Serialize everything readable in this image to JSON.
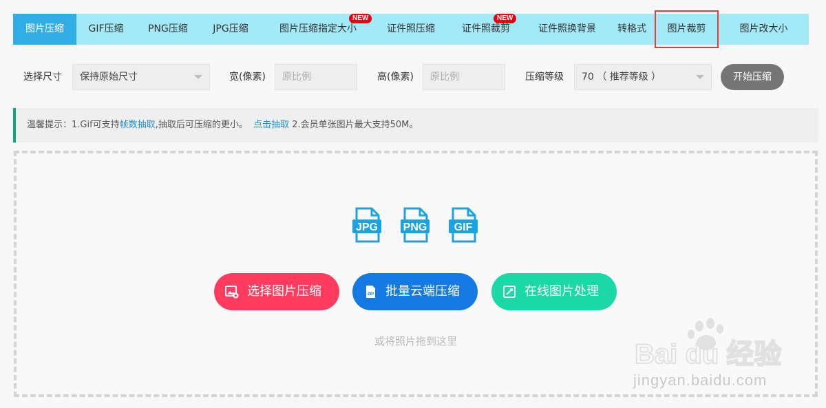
{
  "tabs": [
    {
      "label": "图片压缩",
      "active": true
    },
    {
      "label": "GIF压缩"
    },
    {
      "label": "PNG压缩"
    },
    {
      "label": "JPG压缩"
    },
    {
      "label": "图片压缩指定大小",
      "badge": "NEW"
    },
    {
      "label": "证件照压缩"
    },
    {
      "label": "证件照裁剪",
      "badge": "NEW"
    },
    {
      "label": "证件照换背景"
    },
    {
      "label": "转格式"
    },
    {
      "label": "图片裁剪",
      "highlighted": true
    },
    {
      "label": "图片改大小"
    }
  ],
  "controls": {
    "size_label": "选择尺寸",
    "size_value": "保持原始尺寸",
    "width_label": "宽(像素)",
    "width_placeholder": "原比例",
    "height_label": "高(像素)",
    "height_placeholder": "原比例",
    "level_label": "压缩等级",
    "level_value": "70 （ 推荐等级 ）",
    "start_label": "开始压缩"
  },
  "tip": {
    "prefix": "温馨提示：1.Gif可支持",
    "link1": "帧数抽取",
    "middle": ",抽取后可压缩的更小。",
    "link2": "点击抽取",
    "suffix": " 2.会员单张图片最大支持50M。"
  },
  "upload": {
    "file_types": [
      "JPG",
      "PNG",
      "GIF"
    ],
    "select_label": "选择图片压缩",
    "batch_label": "批量云端压缩",
    "online_label": "在线图片处理",
    "batch_icon_text": "ZIP",
    "drag_hint": "或将照片拖到这里"
  },
  "watermark": {
    "brand": "Bai du 经验",
    "url": "jingyan.baidu.com"
  },
  "colors": {
    "tab_bg": "#a3eaf8",
    "tab_active": "#31aee5",
    "badge": "#e60012",
    "select_btn": "#ff3c5f",
    "batch_btn": "#1479e2",
    "online_btn": "#1bd9a6",
    "file_icon": "#1aa3e0",
    "tip_border": "#15a184"
  }
}
